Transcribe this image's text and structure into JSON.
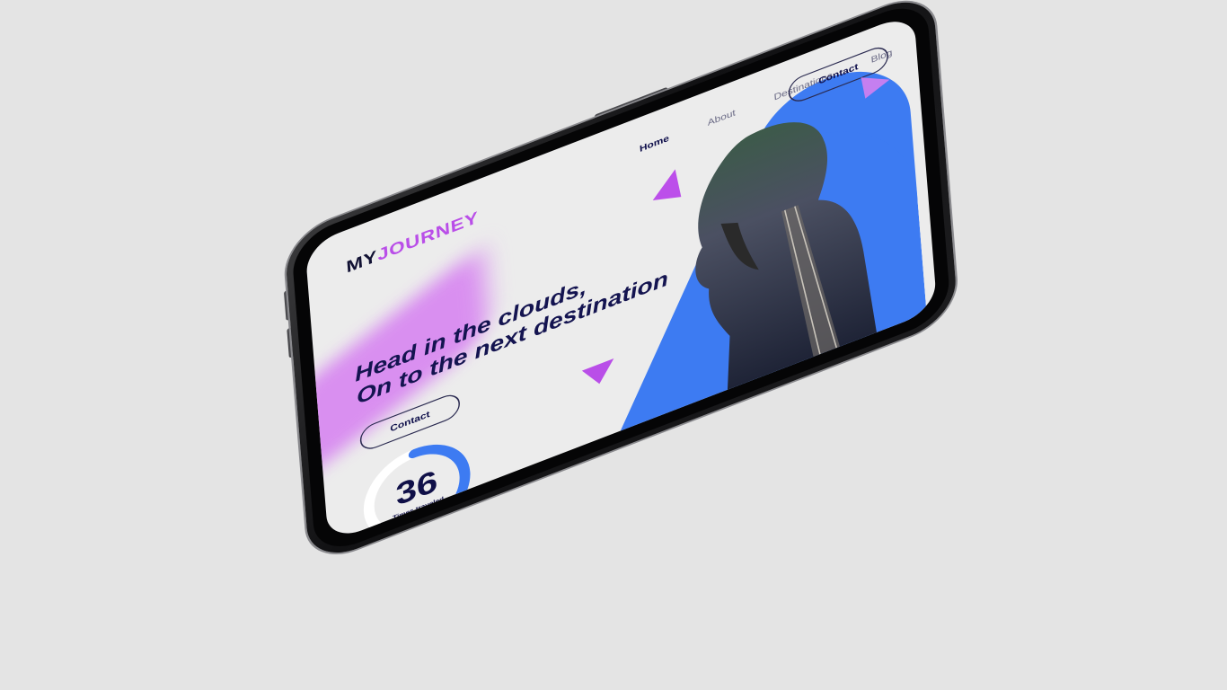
{
  "brand": {
    "part1": "MY",
    "part2": "JOURNEY"
  },
  "nav": {
    "items": [
      {
        "label": "Home",
        "active": true
      },
      {
        "label": "About",
        "active": false
      },
      {
        "label": "Destinations",
        "active": false
      },
      {
        "label": "Blog",
        "active": false
      }
    ],
    "contact_label": "Contact"
  },
  "hero": {
    "line1": "Head in the clouds,",
    "line2": "On to the next destination",
    "contact_label": "Contact"
  },
  "counter": {
    "value": "36",
    "label": "Times traveled",
    "progress_fraction": 0.55
  },
  "colors": {
    "accent_purple": "#b94ee8",
    "accent_blue": "#3d7bf2",
    "navy": "#141450"
  }
}
